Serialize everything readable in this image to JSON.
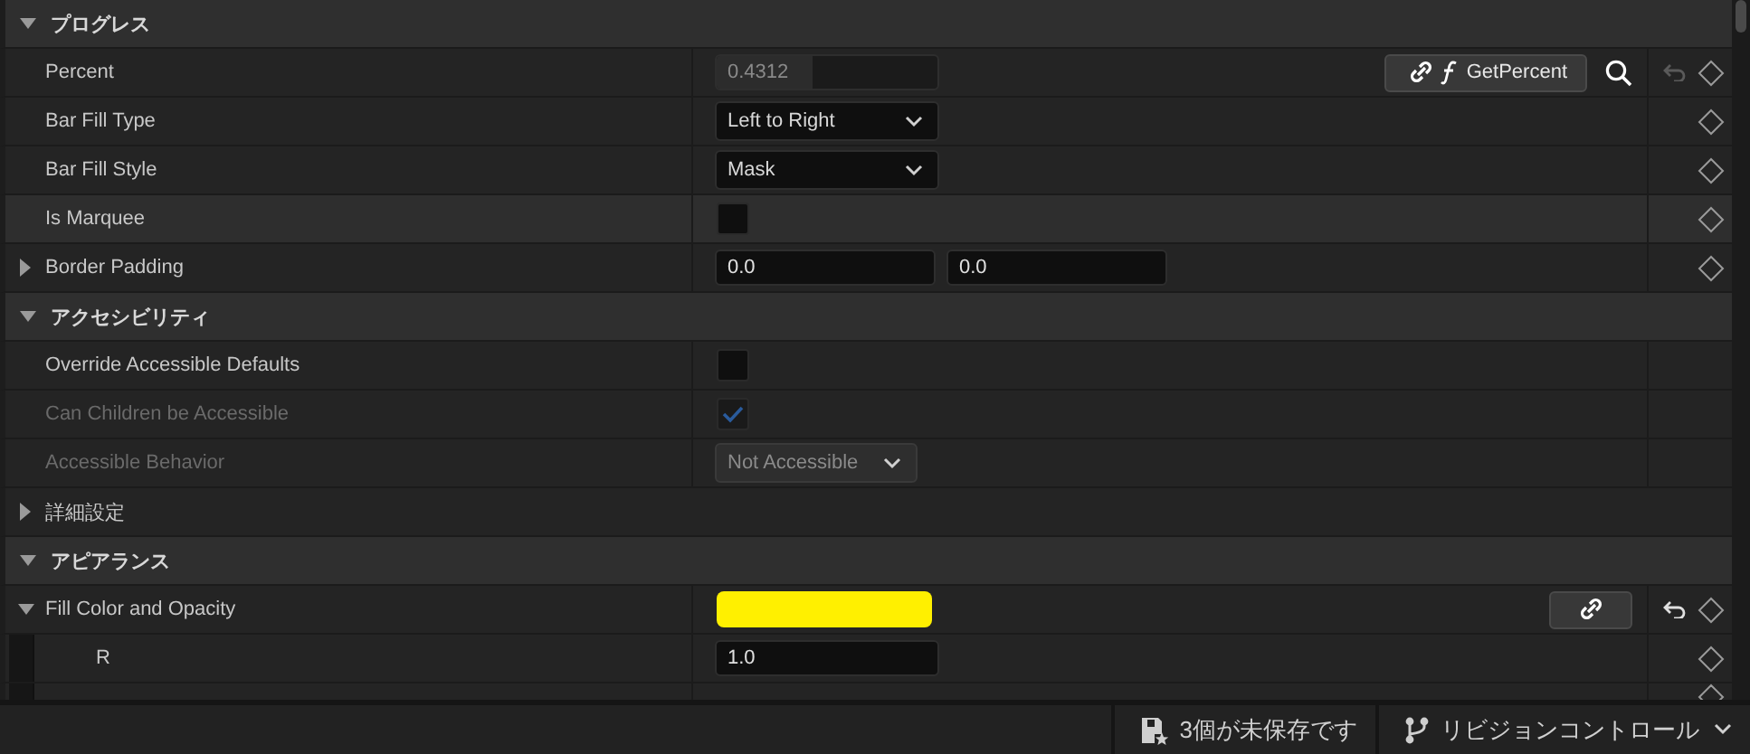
{
  "sections": [
    {
      "title": "プログレス",
      "expanded": true,
      "rows": [
        {
          "kind": "number",
          "label": "Percent",
          "value": "0.4312",
          "level": 0.4312,
          "bound": true,
          "binding": {
            "label": "GetPercent",
            "function": true
          },
          "search": true,
          "reset_enabled": false,
          "keyframe": true
        },
        {
          "kind": "dropdown",
          "label": "Bar Fill Type",
          "value": "Left to Right",
          "keyframe": true
        },
        {
          "kind": "dropdown",
          "label": "Bar Fill Style",
          "value": "Mask",
          "keyframe": true
        },
        {
          "kind": "checkbox",
          "label": "Is Marquee",
          "checked": false,
          "hovered": true,
          "keyframe": true
        },
        {
          "kind": "vector2",
          "label": "Border Padding",
          "expanded": false,
          "values": [
            "0.0",
            "0.0"
          ],
          "keyframe": true
        }
      ]
    },
    {
      "title": "アクセシビリティ",
      "expanded": true,
      "rows": [
        {
          "kind": "checkbox",
          "label": "Override Accessible Defaults",
          "checked": false,
          "keyframe": false
        },
        {
          "kind": "checkbox",
          "label": "Can Children be Accessible",
          "checked": true,
          "disabled": true,
          "keyframe": false
        },
        {
          "kind": "dropdown",
          "label": "Accessible Behavior",
          "value": "Not Accessible",
          "disabled": true,
          "keyframe": false
        },
        {
          "kind": "group",
          "label": "詳細設定",
          "expanded": false
        }
      ]
    },
    {
      "title": "アピアランス",
      "expanded": true,
      "rows": [
        {
          "kind": "color",
          "label": "Fill Color and Opacity",
          "expanded": true,
          "color": "#fff000",
          "binding": {
            "function": false
          },
          "reset_enabled": true,
          "keyframe": true,
          "children": [
            {
              "kind": "number",
              "label": "R",
              "value": "1.0",
              "keyframe": true
            },
            {
              "kind": "cut_row",
              "keyframe": true
            }
          ]
        }
      ]
    }
  ],
  "status_bar": {
    "unsaved": "3個が未保存です",
    "revision_control": "リビジョンコントロール"
  }
}
